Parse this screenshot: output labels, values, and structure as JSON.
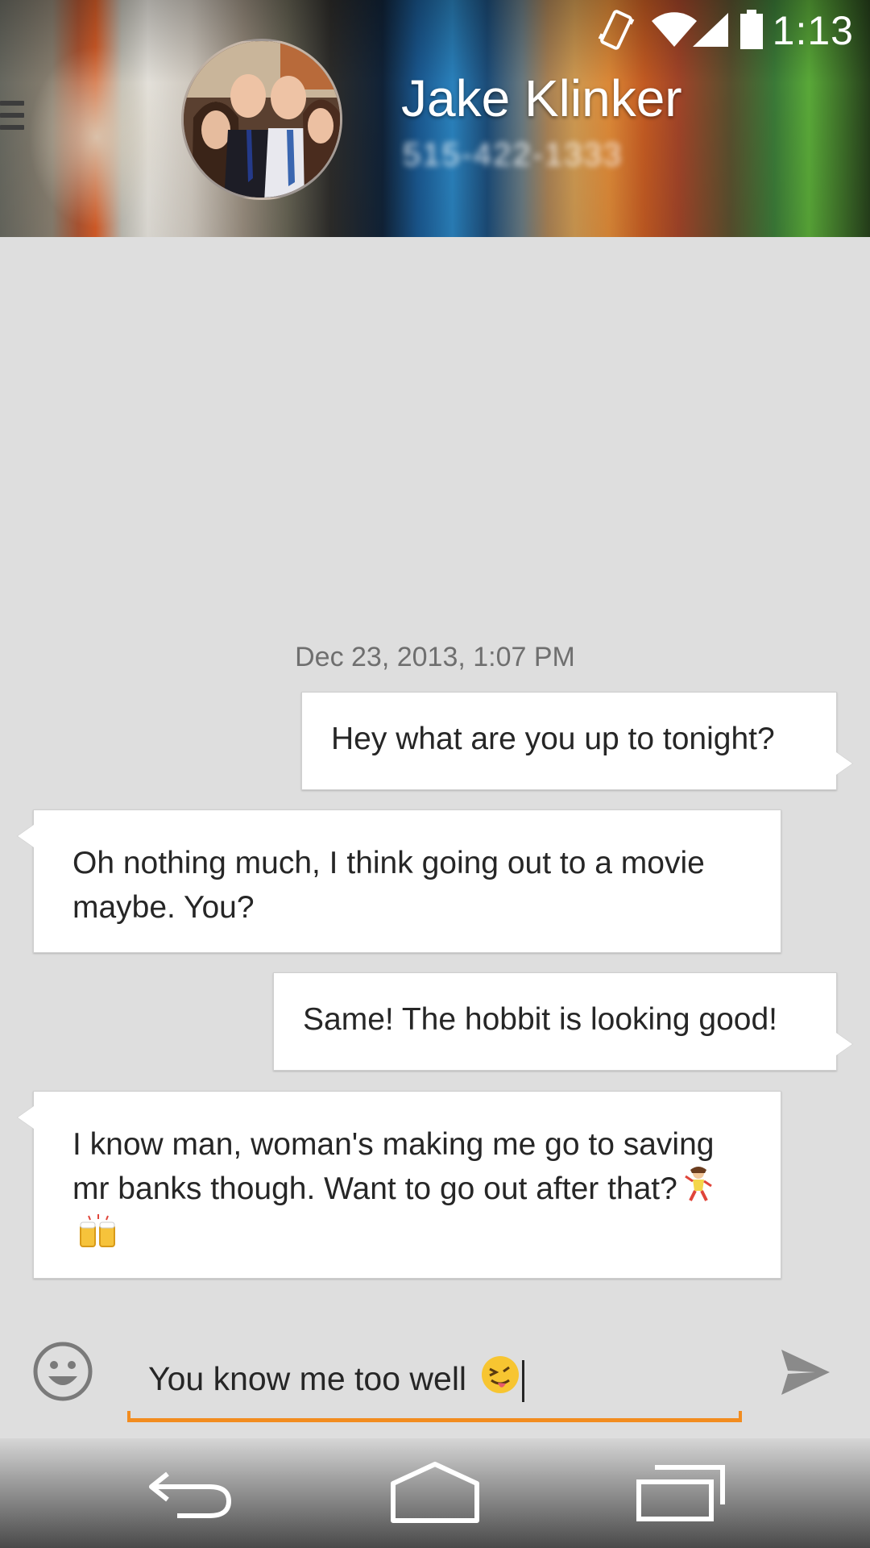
{
  "status_bar": {
    "time": "1:13",
    "icons": [
      "vibrate-icon",
      "wifi-icon",
      "signal-icon",
      "battery-icon"
    ]
  },
  "header": {
    "menu_icon": "hamburger-icon",
    "contact_name": "Jake Klinker",
    "contact_number": "515-422-1333"
  },
  "conversation": {
    "timestamp": "Dec 23, 2013, 1:07 PM",
    "messages": [
      {
        "direction": "sent",
        "text": "Hey what are you up to tonight?"
      },
      {
        "direction": "received",
        "text": "Oh nothing much, I think going out to a movie maybe. You?"
      },
      {
        "direction": "sent",
        "text": "Same! The hobbit is looking good!"
      },
      {
        "direction": "received",
        "text": "I know man, woman's making me go to saving mr banks though. Want to go out after that?",
        "emojis": [
          "dancer-emoji",
          "beer-mugs-emoji"
        ]
      }
    ]
  },
  "compose": {
    "text": "You know me too well",
    "emoji": "winking-tongue-emoji",
    "accent_color": "#f28c1f",
    "emoji_button_icon": "smiley-icon",
    "send_icon": "send-icon"
  },
  "nav_bar": {
    "buttons": [
      "back-icon",
      "home-icon",
      "recents-icon"
    ]
  }
}
